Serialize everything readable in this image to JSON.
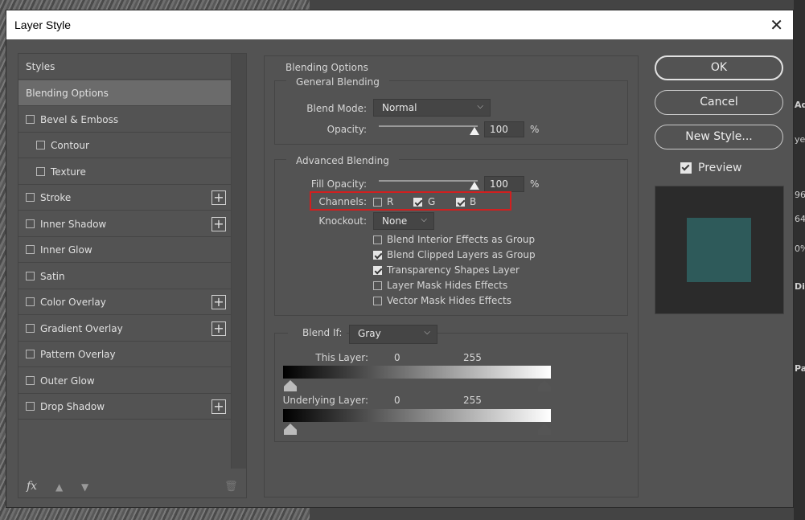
{
  "window": {
    "title": "Layer Style"
  },
  "background": {
    "right_fragments": [
      "Ad",
      "ye",
      "96",
      "64",
      "0%",
      "Di",
      "Pat"
    ]
  },
  "sidebar": {
    "items": [
      {
        "label": "Styles",
        "checkbox": false
      },
      {
        "label": "Blending Options",
        "checkbox": false,
        "selected": true
      },
      {
        "label": "Bevel & Emboss",
        "checkbox": true
      },
      {
        "label": "Contour",
        "checkbox": true,
        "sub": true
      },
      {
        "label": "Texture",
        "checkbox": true,
        "sub": true
      },
      {
        "label": "Stroke",
        "checkbox": true,
        "plus": true
      },
      {
        "label": "Inner Shadow",
        "checkbox": true,
        "plus": true
      },
      {
        "label": "Inner Glow",
        "checkbox": true
      },
      {
        "label": "Satin",
        "checkbox": true
      },
      {
        "label": "Color Overlay",
        "checkbox": true,
        "plus": true
      },
      {
        "label": "Gradient Overlay",
        "checkbox": true,
        "plus": true
      },
      {
        "label": "Pattern Overlay",
        "checkbox": true
      },
      {
        "label": "Outer Glow",
        "checkbox": true
      },
      {
        "label": "Drop Shadow",
        "checkbox": true,
        "plus": true
      }
    ],
    "bottom": {
      "fx": "fx",
      "up": "▲",
      "down": "▼",
      "trash": "🗑"
    }
  },
  "blending": {
    "section_title": "Blending Options",
    "general": {
      "title": "General Blending",
      "blend_mode_label": "Blend Mode:",
      "blend_mode_value": "Normal",
      "opacity_label": "Opacity:",
      "opacity_value": "100",
      "opacity_unit": "%"
    },
    "advanced": {
      "title": "Advanced Blending",
      "fill_opacity_label": "Fill Opacity:",
      "fill_opacity_value": "100",
      "fill_opacity_unit": "%",
      "channels_label": "Channels:",
      "channels": [
        {
          "label": "R",
          "checked": false
        },
        {
          "label": "G",
          "checked": true
        },
        {
          "label": "B",
          "checked": true
        }
      ],
      "knockout_label": "Knockout:",
      "knockout_value": "None",
      "options": [
        {
          "label": "Blend Interior Effects as Group",
          "checked": false
        },
        {
          "label": "Blend Clipped Layers as Group",
          "checked": true
        },
        {
          "label": "Transparency Shapes Layer",
          "checked": true
        },
        {
          "label": "Layer Mask Hides Effects",
          "checked": false
        },
        {
          "label": "Vector Mask Hides Effects",
          "checked": false
        }
      ]
    },
    "blend_if": {
      "label": "Blend If:",
      "value": "Gray",
      "this_layer_label": "This Layer:",
      "this_layer_min": "0",
      "this_layer_max": "255",
      "underlying_label": "Underlying Layer:",
      "underlying_min": "0",
      "underlying_max": "255"
    }
  },
  "buttons": {
    "ok": "OK",
    "cancel": "Cancel",
    "new_style": "New Style..."
  },
  "preview": {
    "label": "Preview",
    "checked": true,
    "swatch_color": "#2e5a5a"
  },
  "colors": {
    "highlight": "#d21f1f"
  }
}
